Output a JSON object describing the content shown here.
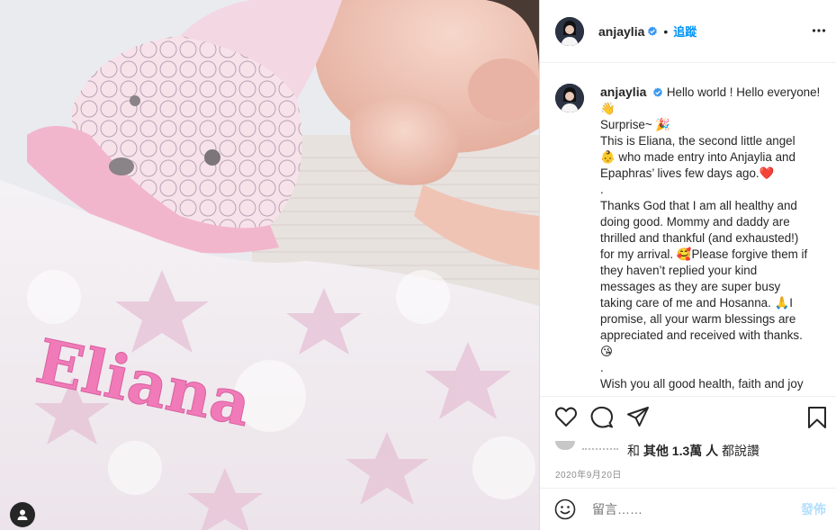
{
  "post": {
    "author": "anjaylia",
    "follow_label": "追蹤",
    "separator": "•",
    "likes_label_prefix": "和",
    "likes_bold": "其他 1.3萬 人",
    "likes_label_suffix": "都說讚",
    "date": "2020年9月20日",
    "comment_placeholder": "留言……",
    "post_button": "發佈",
    "photo_text": "Eliana"
  },
  "caption": {
    "first_line": "Hello world ! Hello everyone!",
    "lines": [
      "👋",
      "Surprise~ 🎉",
      "This is Eliana, the second little angel",
      "👶 who made entry into Anjaylia and",
      "Epaphras’ lives few days ago.❤️",
      ".",
      "Thanks God that I am all healthy and",
      "doing good. Mommy and daddy are",
      "thrilled and thankful (and exhausted!)",
      "for my arrival. 🥰Please forgive them if",
      "they haven’t replied your kind",
      "messages as they are super busy",
      "taking care of me and Hosanna. 🙏I",
      "promise, all your warm blessings are",
      "appreciated and received with thanks.",
      "😘",
      ".",
      "Wish you all good health, faith and joy"
    ]
  },
  "colors": {
    "accent": "#0095f6",
    "post_disabled": "#b2dffc",
    "muted": "#8e8e8e",
    "text": "#262626",
    "embroidery": "#f07bb8"
  },
  "icons": [
    "verified-badge-icon",
    "more-options-icon",
    "heart-icon",
    "comment-icon",
    "share-icon",
    "save-icon",
    "emoji-icon",
    "user-tag-icon"
  ]
}
